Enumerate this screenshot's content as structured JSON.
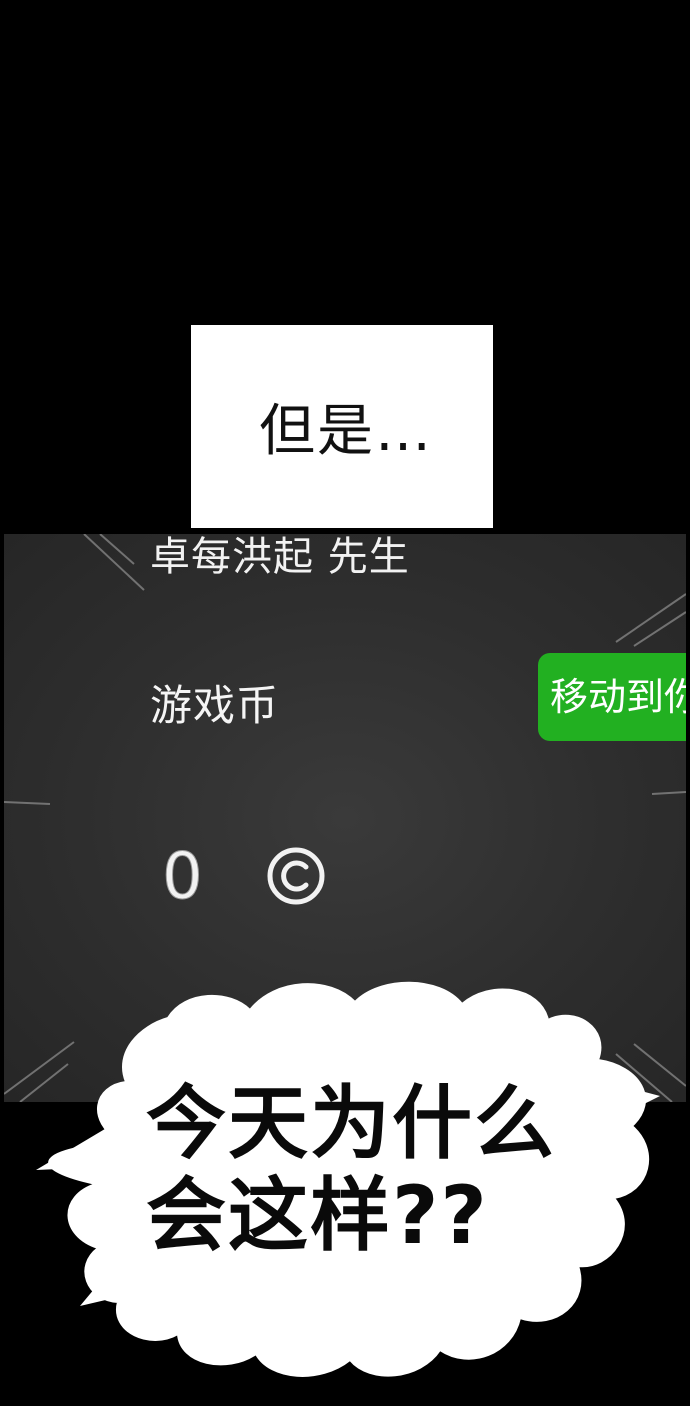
{
  "narration": {
    "text": "但是…"
  },
  "screen": {
    "user_name": "卓每洪起 先生",
    "coins_label": "游戏币",
    "move_button_label": "移动到你",
    "coin_value": "0",
    "coin_icon": "coin-c-icon"
  },
  "shout": {
    "line1": "今天为什么",
    "line2": "会这样??"
  },
  "colors": {
    "background": "#000000",
    "screen": "#2e2e2e",
    "button": "#22b021",
    "bubble": "#ffffff"
  }
}
